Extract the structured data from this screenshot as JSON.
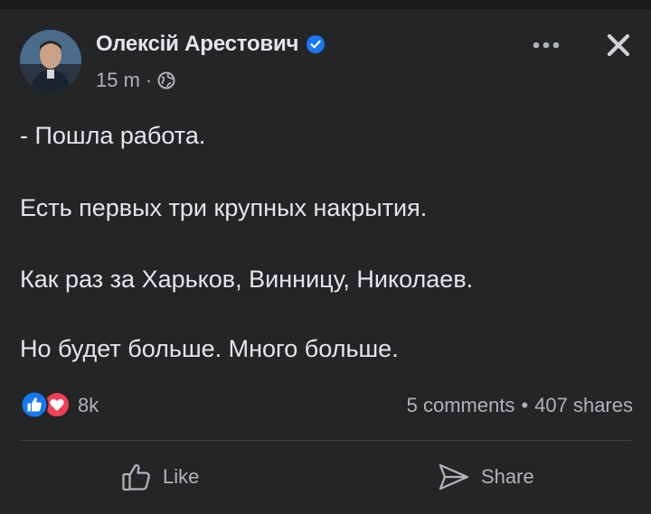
{
  "post": {
    "author": "Олексій Арестович",
    "time": "15 m",
    "separator": "·",
    "lines": [
      "- Пошла работа.",
      "Есть первых три крупных накрытия.",
      "Как раз за Харьков, Винницу, Николаев.",
      "Но будет больше. Много больше."
    ],
    "reaction_count": "8k",
    "comments": "5 comments",
    "stat_separator": "•",
    "shares": "407 shares"
  },
  "actions": {
    "like": "Like",
    "share": "Share"
  },
  "icons": {
    "verified": "verified-badge-icon",
    "privacy": "globe-icon",
    "more": "more-options-icon",
    "close": "close-icon",
    "like_reaction": "like-reaction-icon",
    "love_reaction": "love-reaction-icon",
    "like_button": "thumbs-up-icon",
    "share_button": "share-arrow-icon"
  },
  "colors": {
    "background": "#242526",
    "text_primary": "#e4e6eb",
    "text_secondary": "#b0b3b8",
    "like_blue": "#1877f2",
    "love_red": "#f33e58"
  }
}
